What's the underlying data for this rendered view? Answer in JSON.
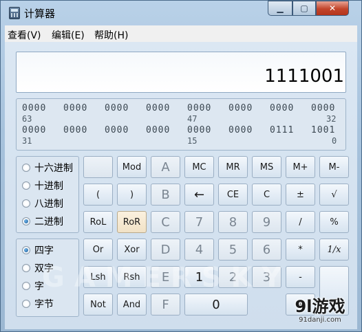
{
  "window": {
    "title": "计算器"
  },
  "menu": [
    "查看(V)",
    "编辑(E)",
    "帮助(H)"
  ],
  "display": {
    "value": "1111001"
  },
  "bits": {
    "row1": [
      "0000",
      "0000",
      "0000",
      "0000",
      "0000",
      "0000",
      "0000",
      "0000"
    ],
    "row1_indices": [
      "63",
      "47",
      "32"
    ],
    "row2": [
      "0000",
      "0000",
      "0000",
      "0000",
      "0000",
      "0000",
      "0111",
      "1001"
    ],
    "row2_indices": [
      "31",
      "15",
      "0"
    ]
  },
  "base_options": [
    {
      "label": "十六进制",
      "checked": false
    },
    {
      "label": "十进制",
      "checked": false
    },
    {
      "label": "八进制",
      "checked": false
    },
    {
      "label": "二进制",
      "checked": true
    }
  ],
  "word_options": [
    {
      "label": "四字",
      "checked": true
    },
    {
      "label": "双字",
      "checked": false
    },
    {
      "label": "字",
      "checked": false
    },
    {
      "label": "字节",
      "checked": false
    }
  ],
  "keys": {
    "row1": [
      "",
      "Mod",
      "A",
      "MC",
      "MR",
      "MS",
      "M+",
      "M-"
    ],
    "row2": [
      "(",
      ")",
      "B",
      "←",
      "CE",
      "C",
      "±",
      "√"
    ],
    "row3": [
      "RoL",
      "RoR",
      "C",
      "7",
      "8",
      "9",
      "/",
      "%"
    ],
    "row4": [
      "Or",
      "Xor",
      "D",
      "4",
      "5",
      "6",
      "*",
      "1/x"
    ],
    "row5": [
      "Lsh",
      "Rsh",
      "E",
      "1",
      "2",
      "3",
      "-",
      "="
    ],
    "row6": [
      "Not",
      "And",
      "F",
      "0",
      "+"
    ]
  },
  "watermark": "GAMERSKY",
  "logo": {
    "main": "9l游戏",
    "sub": "91danji.com"
  }
}
